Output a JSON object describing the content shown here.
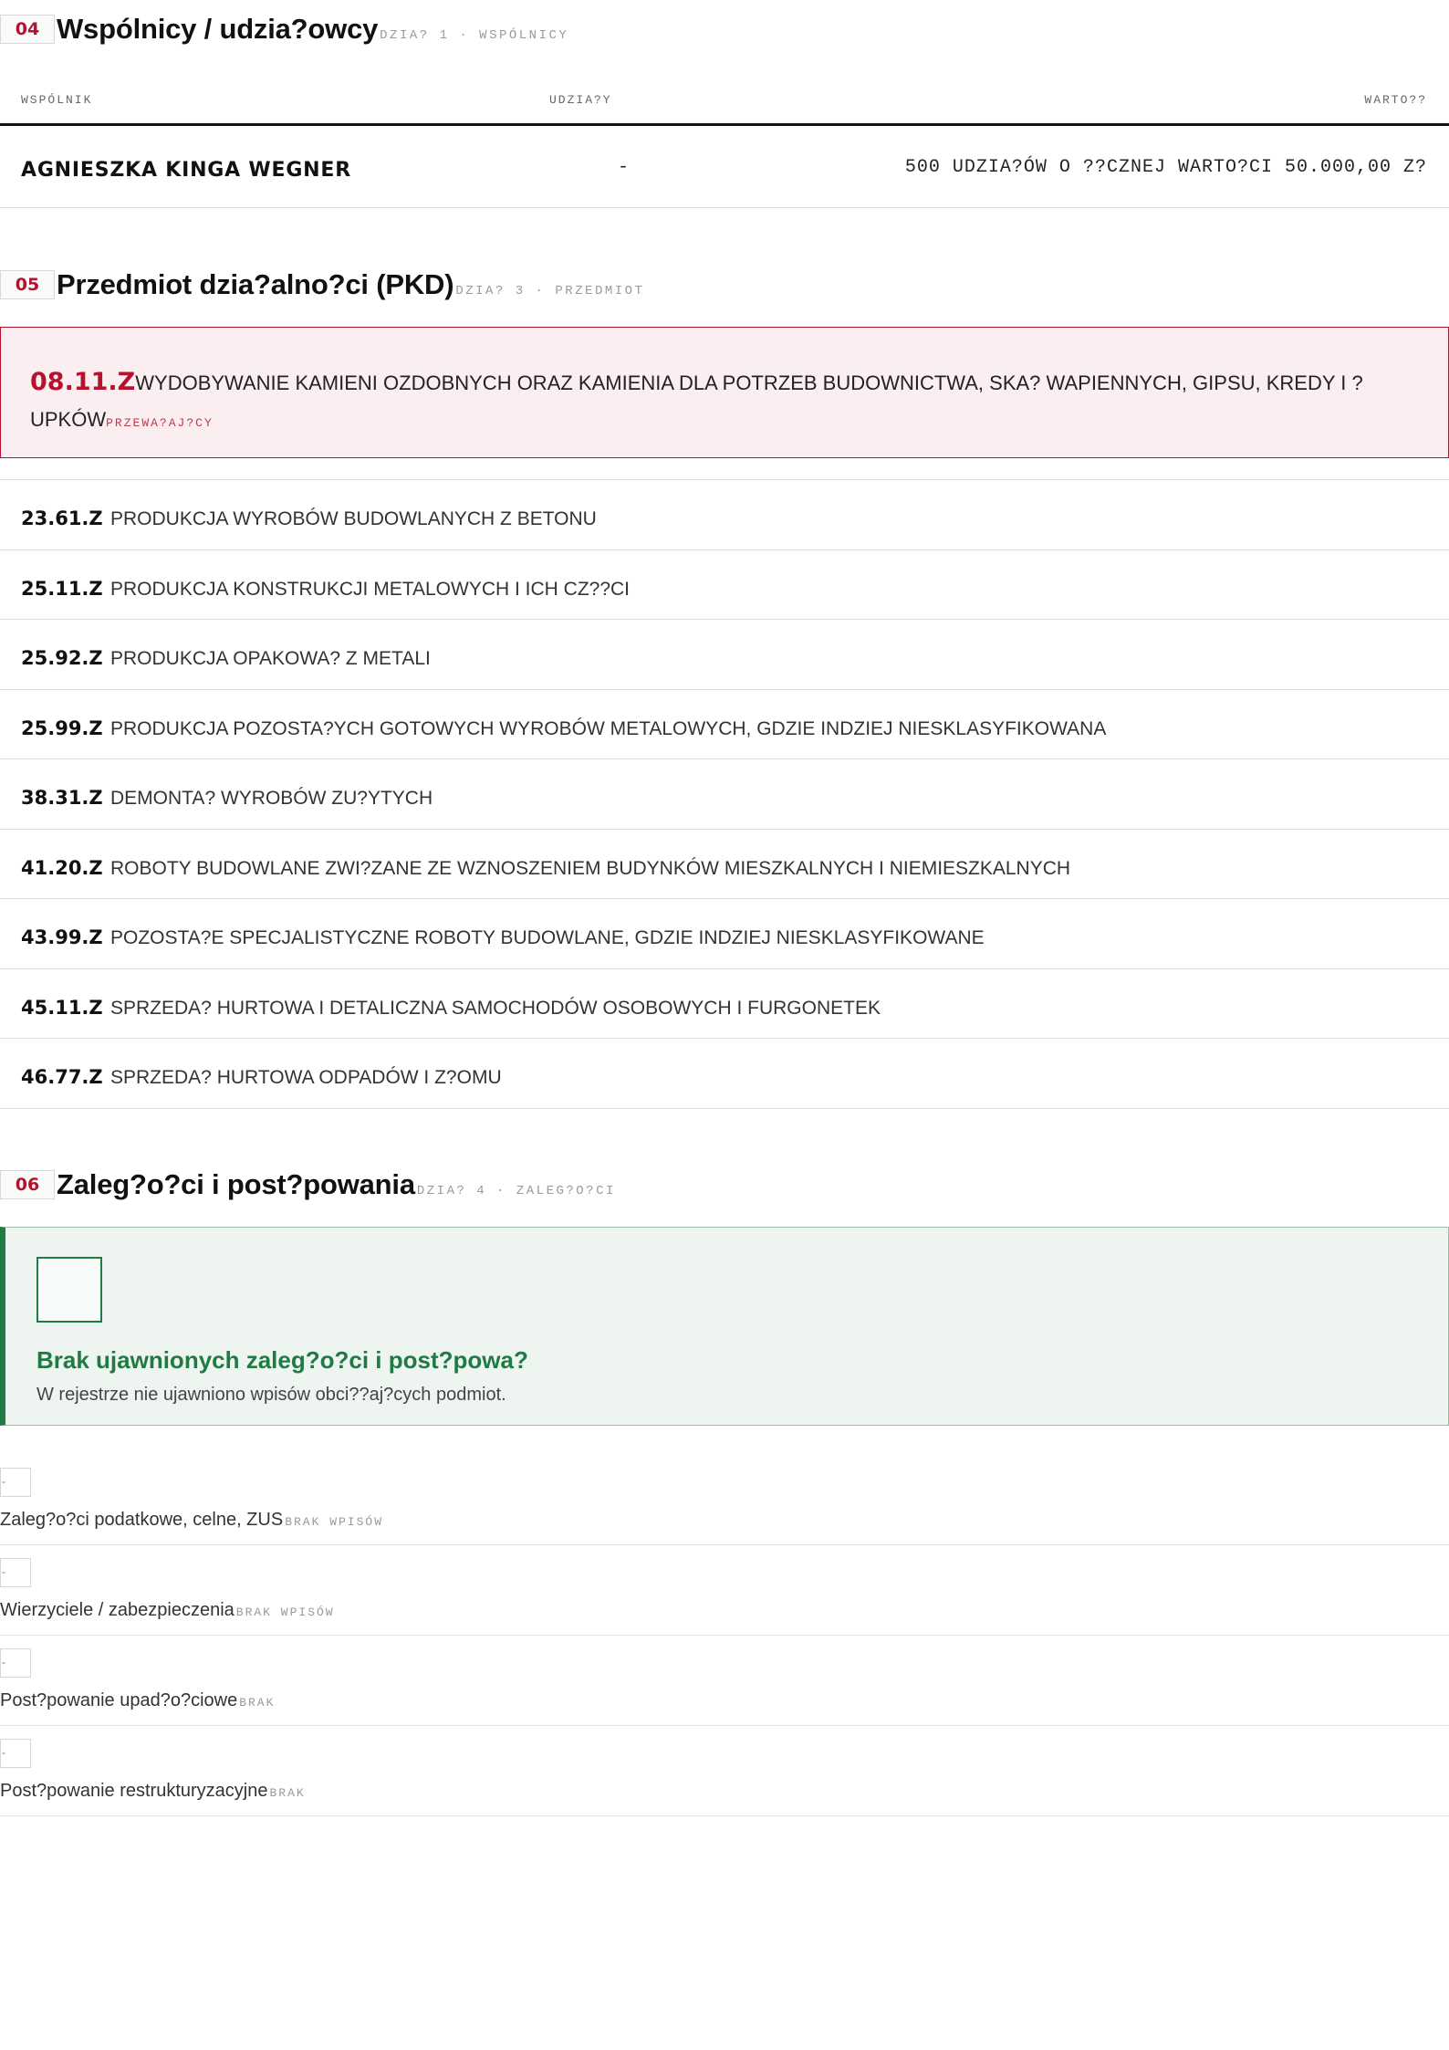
{
  "section_shareholders": {
    "number": "04",
    "title": "Wspólnicy / udzia?owcy",
    "meta": "DZIA? 1 · WSPÓLNICY",
    "columns": [
      "WSPÓLNIK",
      "UDZIA?Y",
      "WARTO??"
    ],
    "rows": [
      {
        "name": "AGNIESZKA KINGA WEGNER",
        "share": "-",
        "value": "500 UDZIA?ÓW O ??CZNEJ WARTO?CI 50.000,00 Z?"
      }
    ]
  },
  "section_pkd": {
    "number": "05",
    "title": "Przedmiot dzia?alno?ci (PKD)",
    "meta": "DZIA? 3 · PRZEDMIOT",
    "main": {
      "code": "08.11.Z",
      "desc": "WYDOBYWANIE KAMIENI OZDOBNYCH ORAZ KAMIENIA DLA POTRZEB BUDOWNICTWA, SKA? WAPIENNYCH, GIPSU, KREDY I ?UPKÓW",
      "tag": "PRZEWA?AJ?CY"
    },
    "items": [
      {
        "code": "23.61.Z",
        "desc": "PRODUKCJA WYROBÓW BUDOWLANYCH Z BETONU"
      },
      {
        "code": "25.11.Z",
        "desc": "PRODUKCJA KONSTRUKCJI METALOWYCH I ICH CZ??CI"
      },
      {
        "code": "25.92.Z",
        "desc": "PRODUKCJA OPAKOWA? Z METALI"
      },
      {
        "code": "25.99.Z",
        "desc": "PRODUKCJA POZOSTA?YCH GOTOWYCH WYROBÓW METALOWYCH, GDZIE INDZIEJ NIESKLASYFIKOWANA"
      },
      {
        "code": "38.31.Z",
        "desc": "DEMONTA? WYROBÓW ZU?YTYCH"
      },
      {
        "code": "41.20.Z",
        "desc": "ROBOTY BUDOWLANE ZWI?ZANE ZE WZNOSZENIEM BUDYNKÓW MIESZKALNYCH I NIEMIESZKALNYCH"
      },
      {
        "code": "43.99.Z",
        "desc": "POZOSTA?E SPECJALISTYCZNE ROBOTY BUDOWLANE, GDZIE INDZIEJ NIESKLASYFIKOWANE"
      },
      {
        "code": "45.11.Z",
        "desc": "SPRZEDA? HURTOWA I DETALICZNA SAMOCHODÓW OSOBOWYCH I FURGONETEK"
      },
      {
        "code": "46.77.Z",
        "desc": "SPRZEDA? HURTOWA ODPADÓW I Z?OMU"
      }
    ]
  },
  "section_debts": {
    "number": "06",
    "title": "Zaleg?o?ci i post?powania",
    "meta": "DZIA? 4 · ZALEG?O?CI",
    "status_title": "Brak ujawnionych zaleg?o?ci i post?powa?",
    "status_text": "W rejestrze nie ujawniono wpisów obci??aj?cych podmiot.",
    "rows": [
      {
        "mark": "-",
        "label": "Zaleg?o?ci podatkowe, celne, ZUS",
        "status": "BRAK WPISÓW"
      },
      {
        "mark": "-",
        "label": "Wierzyciele / zabezpieczenia",
        "status": "BRAK WPISÓW"
      },
      {
        "mark": "-",
        "label": "Post?powanie upad?o?ciowe",
        "status": "BRAK"
      },
      {
        "mark": "-",
        "label": "Post?powanie restrukturyzacyjne",
        "status": "BRAK"
      }
    ]
  },
  "colors": {
    "accent": "#b5122e",
    "success": "#1f7a44",
    "success_bg": "#eef5f0",
    "accent_bg": "#fbeef0"
  }
}
